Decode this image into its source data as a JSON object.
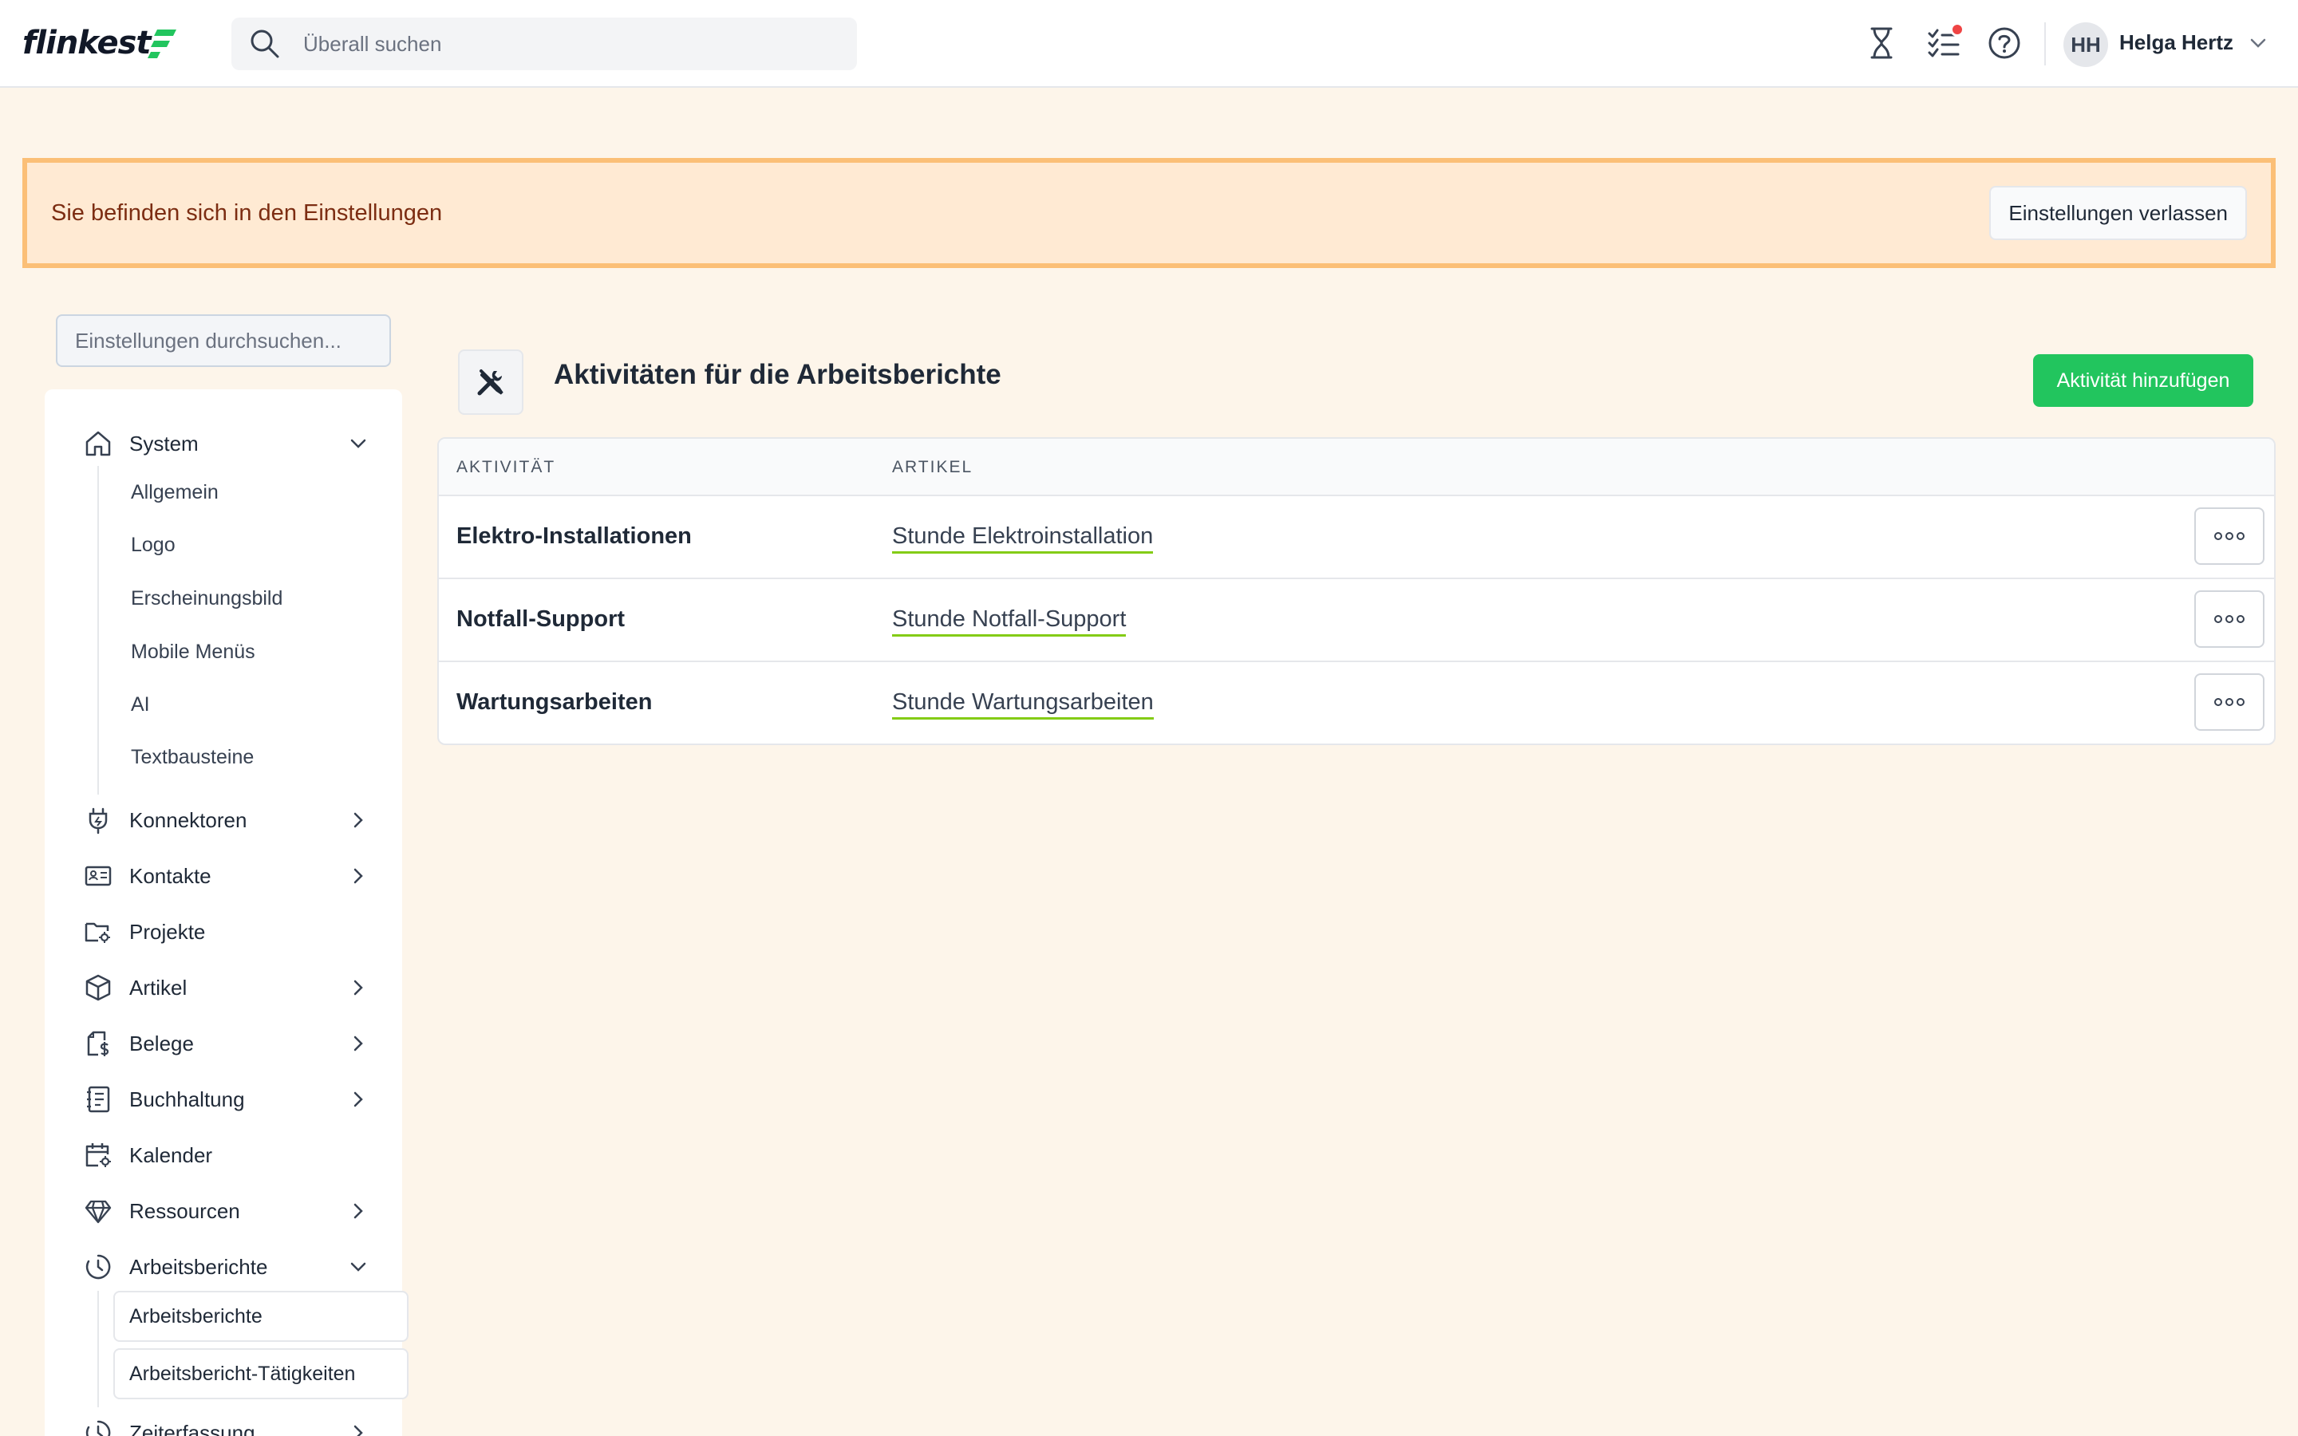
{
  "app": {
    "logo_text": "flinkest",
    "search_placeholder": "Überall suchen",
    "user": {
      "initials": "HH",
      "name": "Helga Hertz"
    },
    "icons": [
      "hourglass-icon",
      "tasks-icon",
      "help-icon"
    ],
    "colors": {
      "accent": "#22c55e",
      "banner_bg": "#ffead3",
      "banner_border": "#fbbf77",
      "notification": "#ef4444"
    }
  },
  "banner": {
    "text": "Sie befinden sich in den Einstellungen",
    "button": "Einstellungen verlassen"
  },
  "sidebar": {
    "search_placeholder": "Einstellungen durchsuchen...",
    "items": {
      "system": "System",
      "system_sub": [
        "Allgemein",
        "Logo",
        "Erscheinungsbild",
        "Mobile Menüs",
        "AI",
        "Textbausteine"
      ],
      "konnektoren": "Konnektoren",
      "kontakte": "Kontakte",
      "projekte": "Projekte",
      "artikel": "Artikel",
      "belege": "Belege",
      "buchhaltung": "Buchhaltung",
      "kalender": "Kalender",
      "ressourcen": "Ressourcen",
      "arbeitsberichte": "Arbeitsberichte",
      "arbeitsberichte_sub": [
        "Arbeitsberichte",
        "Arbeitsbericht-Tätigkeiten"
      ],
      "zeiterfassung": "Zeiterfassung"
    }
  },
  "main": {
    "title": "Aktivitäten für die Arbeitsberichte",
    "add_button": "Aktivität hinzufügen",
    "columns": [
      "AKTIVITÄT",
      "ARTIKEL"
    ],
    "rows": [
      {
        "activity": "Elektro-Installationen",
        "article": "Stunde Elektroinstallation"
      },
      {
        "activity": "Notfall-Support",
        "article": "Stunde Notfall-Support"
      },
      {
        "activity": "Wartungsarbeiten",
        "article": "Stunde Wartungsarbeiten"
      }
    ]
  }
}
